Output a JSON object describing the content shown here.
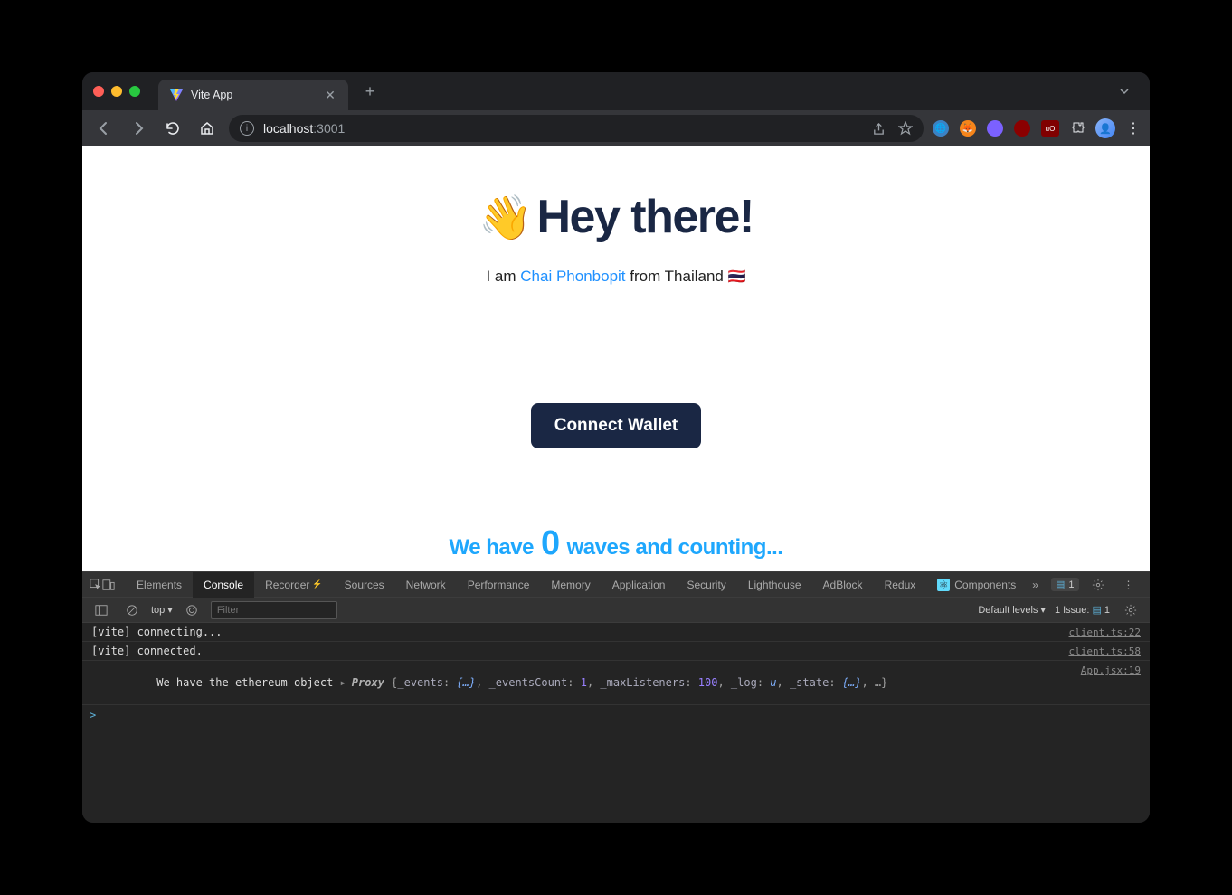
{
  "browser": {
    "tab_title": "Vite App",
    "url_host": "localhost",
    "url_port": ":3001"
  },
  "hero": {
    "emoji": "👋",
    "title": "Hey there!",
    "intro_prefix": "I am ",
    "intro_link": "Chai Phonbopit",
    "intro_suffix": " from Thailand ",
    "flag": "🇹🇭"
  },
  "connect_button": "Connect Wallet",
  "waves": {
    "prefix": "We have ",
    "count": "0",
    "suffix": " waves and counting..."
  },
  "devtools": {
    "tabs": [
      "Elements",
      "Console",
      "Recorder",
      "Sources",
      "Network",
      "Performance",
      "Memory",
      "Application",
      "Security",
      "Lighthouse",
      "AdBlock",
      "Redux",
      "Components"
    ],
    "active_tab": "Console",
    "more_tabs": "»",
    "badge_count": "1",
    "filter_placeholder": "Filter",
    "context_label": "top",
    "levels_label": "Default levels",
    "issues_label": "1 Issue:",
    "issues_count": "1",
    "logs": [
      {
        "text": "[vite] connecting...",
        "source": "client.ts:22"
      },
      {
        "text": "[vite] connected.",
        "source": "client.ts:58"
      },
      {
        "text_prefix": "We have the ethereum object ",
        "expand": true,
        "proxy": "Proxy {_events: {…}, _eventsCount: 1, _maxListeners: 100, _log: u, _state: {…}, …}",
        "source": "App.jsx:19"
      }
    ],
    "prompt": ">"
  }
}
